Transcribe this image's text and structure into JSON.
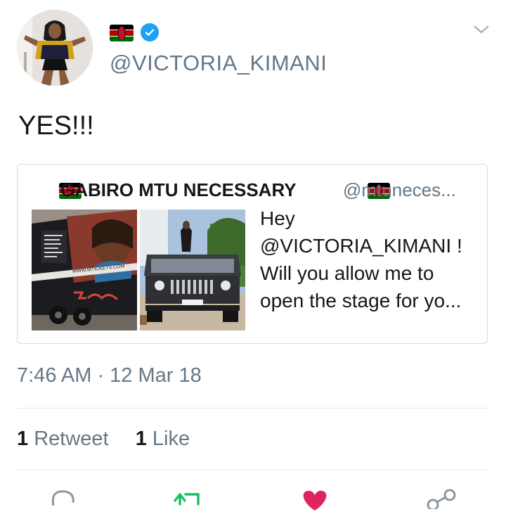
{
  "header": {
    "handle": "@VICTORIA_KIMANI",
    "icons": [
      "kenya-flag-icon",
      "verified-badge-icon",
      "chevron-down-icon"
    ]
  },
  "tweet": {
    "text": "YES!!!"
  },
  "quote": {
    "name": "GABIRO MTU NECESSARY",
    "handle": "@mtuneces...",
    "body_lines": [
      "Hey",
      "@VICTORIA_KIMANI !",
      "Will you allow me to",
      "open the stage for yo..."
    ],
    "media": {
      "poster_text": "WWW.MTICKETS.COM"
    }
  },
  "meta": {
    "timestamp": "7:46 AM · 12 Mar 18"
  },
  "stats": {
    "retweets_count": "1",
    "retweets_label": "Retweet",
    "likes_count": "1",
    "likes_label": "Like"
  },
  "actions": [
    "reply-icon",
    "retweet-icon",
    "like-icon",
    "share-icon"
  ],
  "colors": {
    "primary_text": "#14171a",
    "secondary_text": "#657786",
    "verified_blue": "#1da1f2",
    "retweet_green": "#17bf63",
    "like_red": "#e0245e",
    "border": "#e1e8ed"
  }
}
